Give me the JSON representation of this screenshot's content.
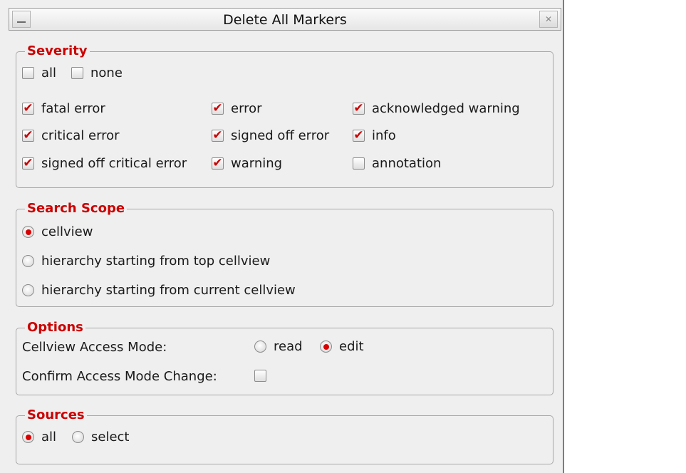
{
  "window": {
    "title": "Delete All Markers"
  },
  "severity": {
    "legend": "Severity",
    "all_label": "all",
    "all_checked": false,
    "none_label": "none",
    "none_checked": false,
    "items": [
      {
        "label": "fatal error",
        "checked": true
      },
      {
        "label": "error",
        "checked": true
      },
      {
        "label": "acknowledged warning",
        "checked": true
      },
      {
        "label": "critical error",
        "checked": true
      },
      {
        "label": "signed off error",
        "checked": true
      },
      {
        "label": "info",
        "checked": true
      },
      {
        "label": "signed off critical error",
        "checked": true
      },
      {
        "label": "warning",
        "checked": true
      },
      {
        "label": "annotation",
        "checked": false
      }
    ]
  },
  "scope": {
    "legend": "Search Scope",
    "options": [
      {
        "label": "cellview",
        "selected": true
      },
      {
        "label": "hierarchy starting from top cellview",
        "selected": false
      },
      {
        "label": "hierarchy starting from current cellview",
        "selected": false
      }
    ]
  },
  "options": {
    "legend": "Options",
    "access_mode_label": "Cellview Access Mode:",
    "access_modes": [
      {
        "label": "read",
        "selected": false
      },
      {
        "label": "edit",
        "selected": true
      }
    ],
    "confirm_label": "Confirm Access Mode Change:",
    "confirm_checked": false
  },
  "sources": {
    "legend": "Sources",
    "options": [
      {
        "label": "all",
        "selected": true
      },
      {
        "label": "select",
        "selected": false
      }
    ]
  },
  "colors": {
    "accent": "#cc0000",
    "panel": "#efefef",
    "border": "#a8a8a8"
  }
}
